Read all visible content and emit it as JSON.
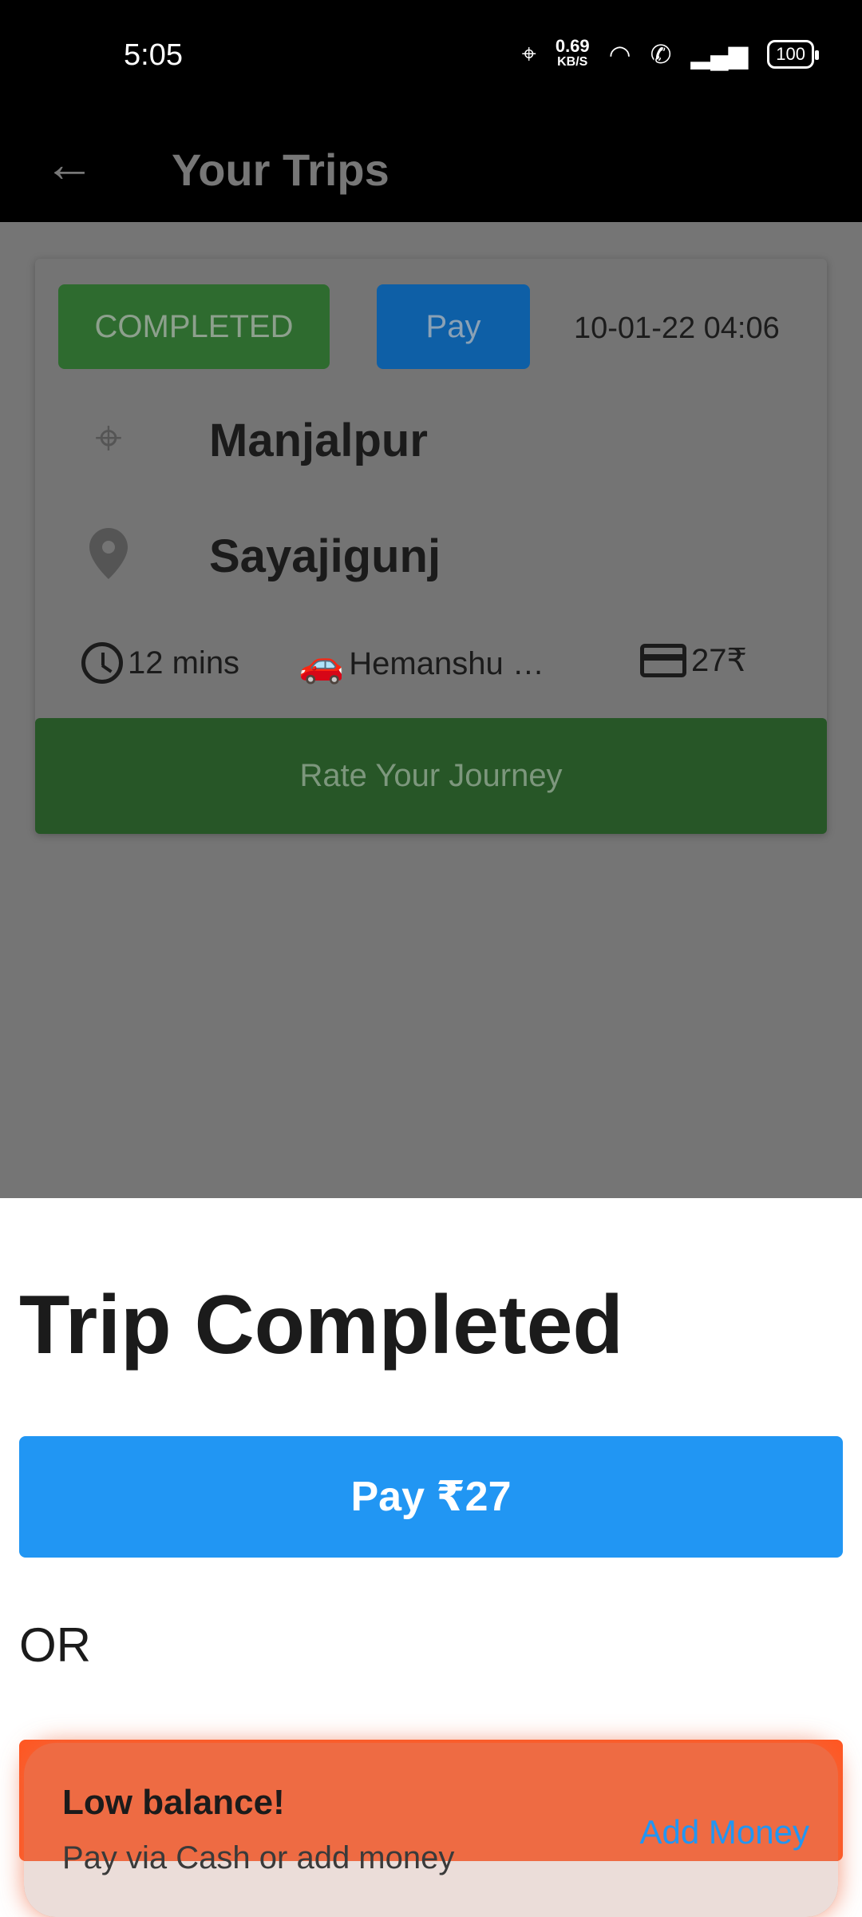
{
  "status_bar": {
    "time": "5:05",
    "net_speed": "0.69",
    "net_unit": "KB/S",
    "battery": "100"
  },
  "appbar": {
    "back_icon": "arrow-left-icon",
    "title": "Your Trips"
  },
  "trip": {
    "status": "COMPLETED",
    "pay_label": "Pay",
    "datetime": "10-01-22 04:06",
    "from": "Manjalpur",
    "to": "Sayajigunj",
    "duration": "12 mins",
    "driver": "Hemanshu …",
    "fare": "27₹",
    "rate_label": "Rate Your Journey"
  },
  "sheet": {
    "heading": "Trip Completed",
    "pay_button": "Pay ₹27",
    "or_label": "OR"
  },
  "toast": {
    "title": "Low balance!",
    "subtitle": "Pay via Cash or add money",
    "action": "Add Money"
  },
  "colors": {
    "completed_green": "#2e6b2f",
    "pay_blue": "#2196f3",
    "cash_orange": "#ff5722"
  }
}
